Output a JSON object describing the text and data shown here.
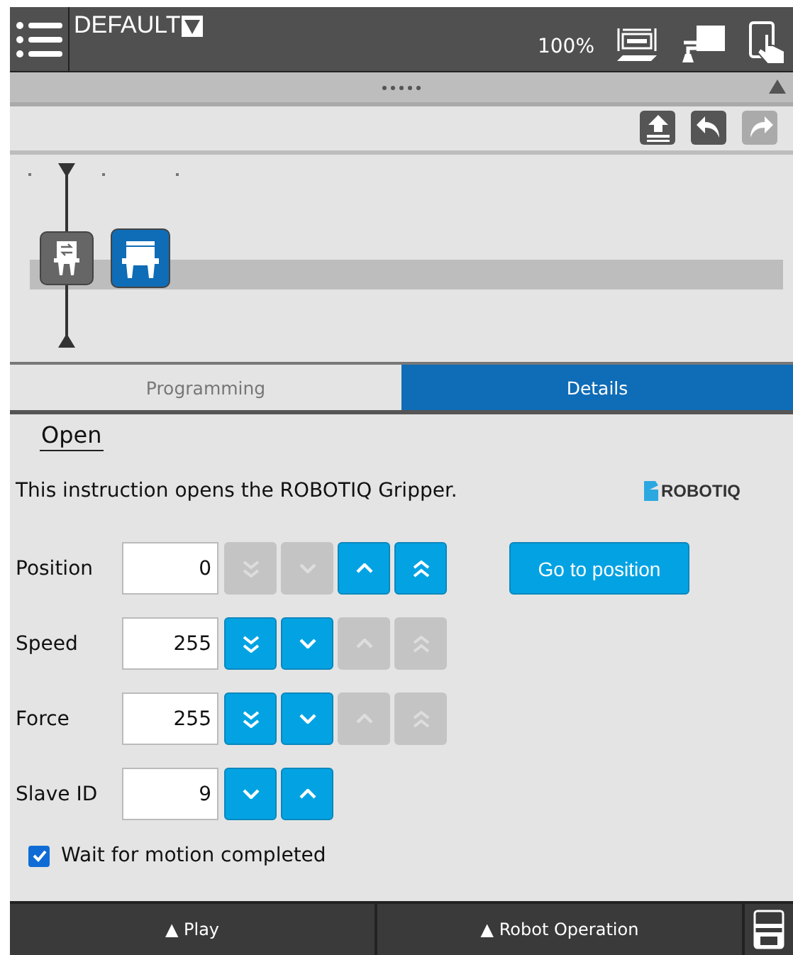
{
  "header": {
    "title": "DEFAULT",
    "speed": "100%"
  },
  "toolbar": [
    {
      "kind": "upload",
      "disabled": false
    },
    {
      "kind": "undo",
      "disabled": false
    },
    {
      "kind": "redo",
      "disabled": true
    }
  ],
  "timeline": {
    "nodes": [
      {
        "kind": "setup",
        "selected": false
      },
      {
        "kind": "open",
        "selected": true
      }
    ]
  },
  "tabs": [
    {
      "label": "Programming",
      "selected": false
    },
    {
      "label": "Details",
      "selected": true
    }
  ],
  "details": {
    "title": "Open",
    "description": "This instruction opens the ROBOTIQ Gripper.",
    "logo": "ROBOTIQ",
    "fields": [
      {
        "label": "Position",
        "value": "0",
        "buttons": [
          {
            "kind": "double-down",
            "disabled": true
          },
          {
            "kind": "down",
            "disabled": true
          },
          {
            "kind": "up",
            "disabled": false
          },
          {
            "kind": "double-up",
            "disabled": false
          }
        ],
        "action": "Go to position"
      },
      {
        "label": "Speed",
        "value": "255",
        "buttons": [
          {
            "kind": "double-down",
            "disabled": false
          },
          {
            "kind": "down",
            "disabled": false
          },
          {
            "kind": "up",
            "disabled": true
          },
          {
            "kind": "double-up",
            "disabled": true
          }
        ]
      },
      {
        "label": "Force",
        "value": "255",
        "buttons": [
          {
            "kind": "double-down",
            "disabled": false
          },
          {
            "kind": "down",
            "disabled": false
          },
          {
            "kind": "up",
            "disabled": true
          },
          {
            "kind": "double-up",
            "disabled": true
          }
        ]
      },
      {
        "label": "Slave ID",
        "value": "9",
        "buttons": [
          {
            "kind": "down",
            "disabled": false
          },
          {
            "kind": "up",
            "disabled": false
          }
        ]
      }
    ],
    "wait": {
      "label": "Wait for motion completed",
      "checked": true
    }
  },
  "footer": {
    "buttons": [
      {
        "arrow": "▲",
        "label": "Play"
      },
      {
        "arrow": "▲",
        "label": "Robot Operation"
      }
    ]
  }
}
